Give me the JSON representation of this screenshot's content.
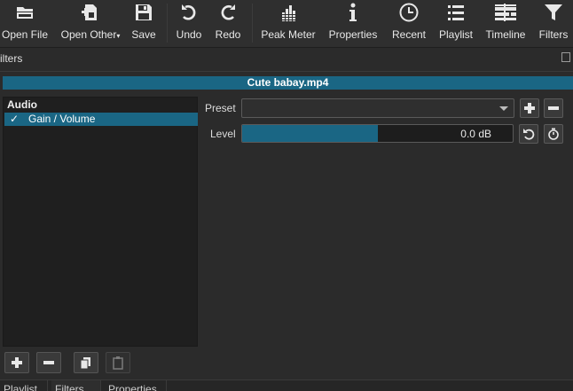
{
  "toolbar": {
    "open_file": "Open File",
    "open_other": "Open Other",
    "save": "Save",
    "undo": "Undo",
    "redo": "Redo",
    "peak_meter": "Peak Meter",
    "properties": "Properties",
    "recent": "Recent",
    "playlist": "Playlist",
    "timeline": "Timeline",
    "filters": "Filters"
  },
  "filters_panel": {
    "title": "ilters",
    "clip_name": "Cute babay.mp4",
    "group": "Audio",
    "items": [
      {
        "checked": "✓",
        "name": "Gain / Volume"
      }
    ],
    "preset_label": "Preset",
    "preset_value": "",
    "level_label": "Level",
    "level_value": "0.0 dB",
    "level_fraction": 0.5
  },
  "tabs": [
    "Playlist",
    "Filters",
    "Properties"
  ],
  "colors": {
    "accent": "#1a6684",
    "background": "#2b2b2b",
    "list_bg": "#1f1f1f"
  }
}
